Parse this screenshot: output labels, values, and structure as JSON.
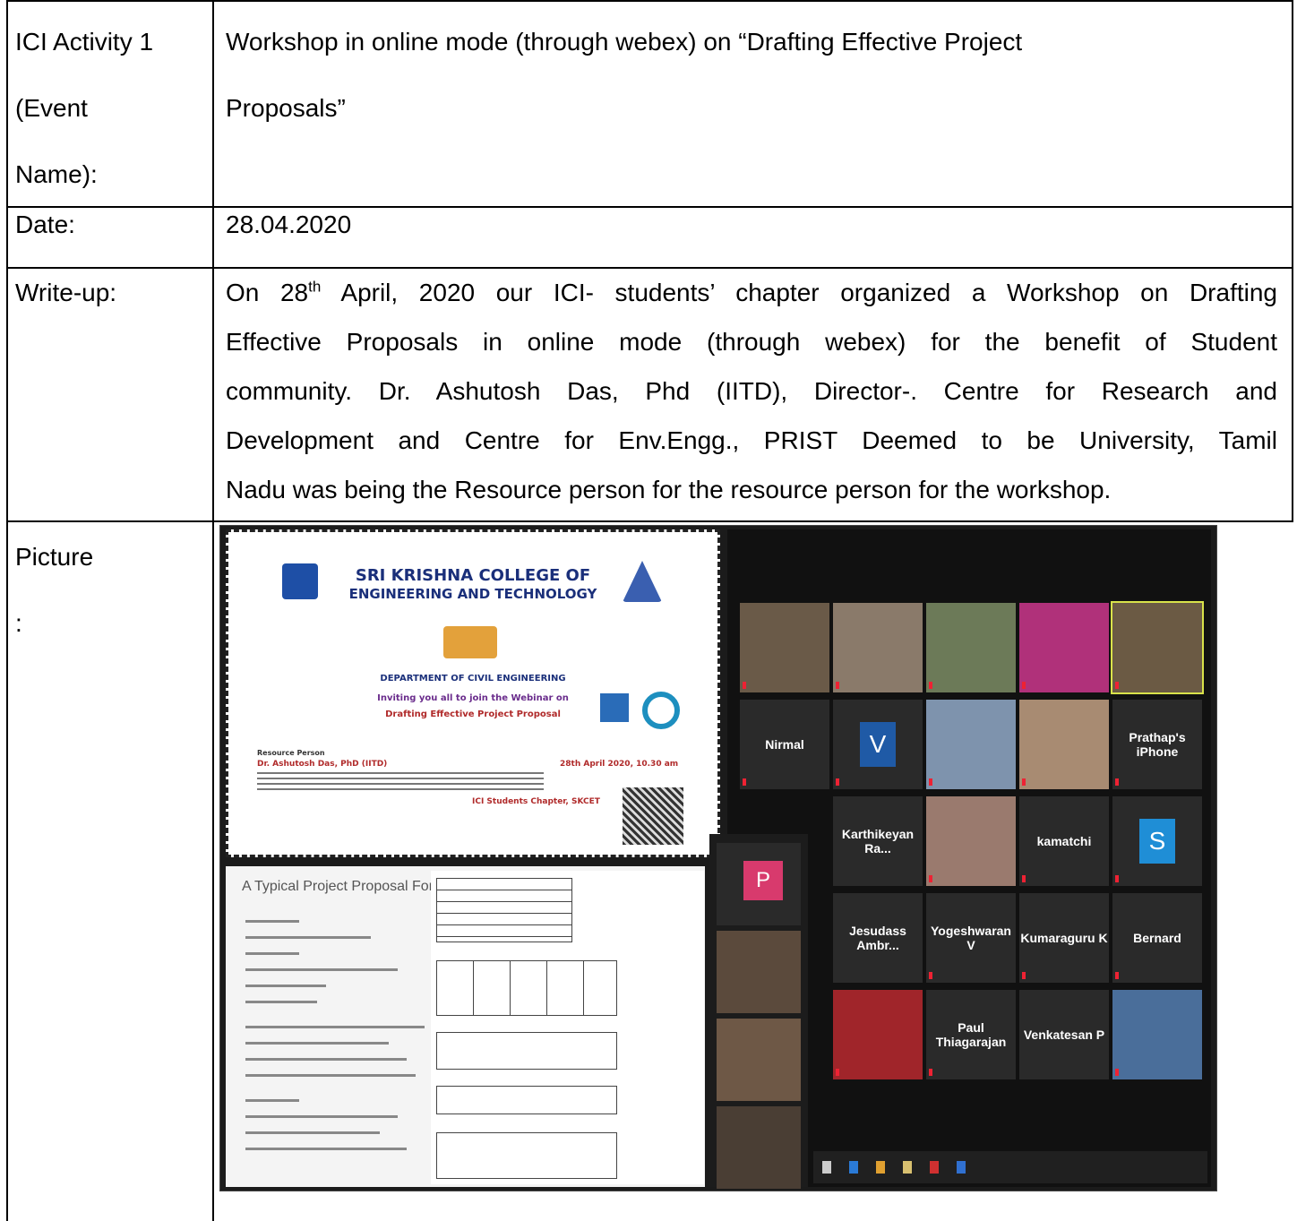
{
  "rows": [
    {
      "label_lines": [
        "ICI Activity 1",
        "(Event",
        "Name):"
      ],
      "value_lines": [
        "Workshop in online mode (through webex) on “Drafting Effective Project",
        "Proposals”"
      ]
    },
    {
      "label_lines": [
        "Date:"
      ],
      "value_lines": [
        "28.04.2020"
      ]
    },
    {
      "label_lines": [
        "Write-up:"
      ],
      "writeup": {
        "l1_pre": "On 28",
        "l1_sup": "th",
        "l1_post": " April, 2020 our ICI- students’ chapter organized a Workshop on Drafting",
        "l2": "Effective Proposals in online mode (through webex) for the benefit of Student",
        "l3": "community. Dr. Ashutosh Das, Phd (IITD), Director-. Centre for Research and",
        "l4": "Development and Centre for Env.Engg., PRIST Deemed to be University, Tamil",
        "l5": "Nadu was being the Resource person for the resource person for the workshop."
      }
    },
    {
      "label_lines": [
        "Picture",
        ":"
      ]
    }
  ],
  "picture": {
    "poster": {
      "college": "SRI KRISHNA COLLEGE OF",
      "college2": "ENGINEERING AND TECHNOLOGY",
      "dept": "DEPARTMENT OF CIVIL ENGINEERING",
      "invite": "Inviting you all to join the Webinar on",
      "topic": "Drafting Effective Project Proposal",
      "resource_label": "Resource Person",
      "speaker": "Dr. Ashutosh Das, PhD (IITD)",
      "date": "28th April 2020, 10.30 am",
      "chapter": "ICI Students Chapter, SKCET"
    },
    "proposal_heading": "A Typical Project Proposal Format",
    "zoom_tiles": [
      {
        "label": "Nirmal"
      },
      {
        "label": "Prathap's iPhone"
      },
      {
        "label": "Karthikeyan Ra..."
      },
      {
        "label": "kamatchi"
      },
      {
        "label": "Jesudass Ambr..."
      },
      {
        "label": "Yogeshwaran V"
      },
      {
        "label": "Kumaraguru K"
      },
      {
        "label": "Bernard"
      },
      {
        "label": "Paul Thiagarajan"
      },
      {
        "label": "Venkatesan P"
      }
    ],
    "avatars": {
      "v": "V",
      "s": "S",
      "p": "P"
    }
  }
}
